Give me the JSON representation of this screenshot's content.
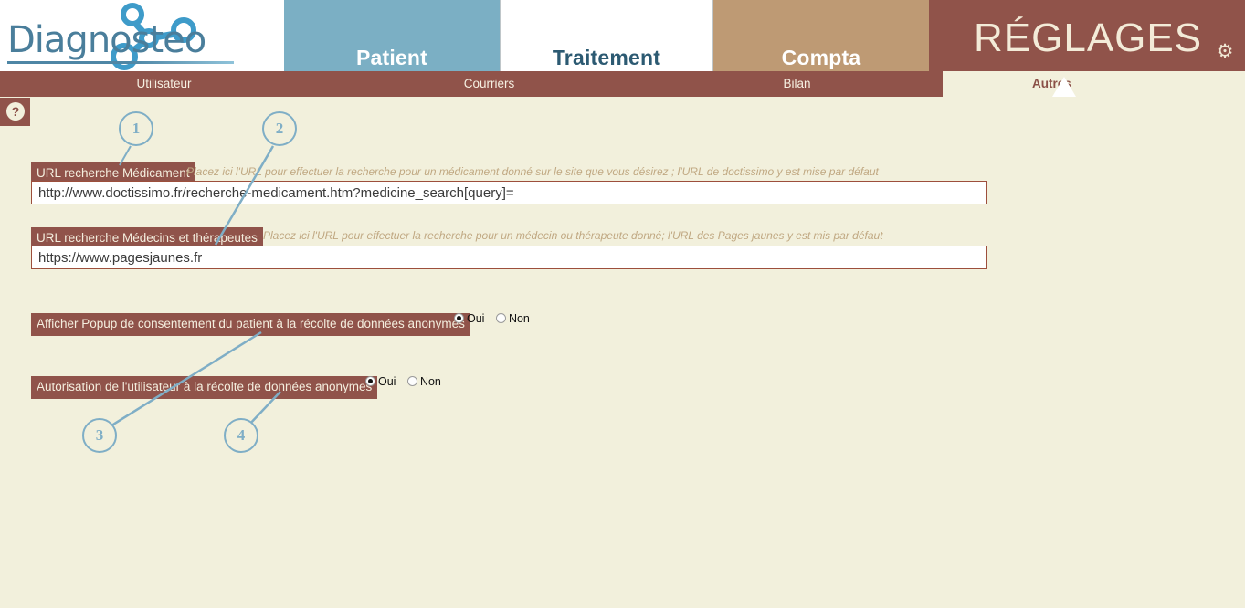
{
  "app": {
    "logo_text": "Diagnosteo",
    "page_title": "RÉGLAGES",
    "gear_icon": "gear-icon",
    "help_icon": "?"
  },
  "colors": {
    "brown": "#90534A",
    "background": "#F2F0DC",
    "patient_tab": "#7BAFC4",
    "compta_tab": "#BE9A74",
    "callout_blue": "#7FAEC6",
    "hint_text": "#C0A882",
    "input_border": "#9D4F3C"
  },
  "main_tabs": [
    {
      "label": "Patient",
      "active": false
    },
    {
      "label": "Traitement",
      "active": true
    },
    {
      "label": "Compta",
      "active": false
    }
  ],
  "sub_tabs": [
    {
      "label": "Utilisateur"
    },
    {
      "label": "Courriers"
    },
    {
      "label": "Bilan"
    },
    {
      "label": "Autres"
    }
  ],
  "form": {
    "rows": [
      {
        "label": "URL recherche Médicament",
        "hint": "Placez ici l'URL pour effectuer la recherche pour un médicament donné sur le site que vous désirez ; l'URL de doctissimo y est mise par défaut",
        "value": "http://www.doctissimo.fr/recherche-medicament.htm?medicine_search[query]="
      },
      {
        "label": "URL recherche Médecins et thérapeutes",
        "hint": "Placez ici l'URL pour effectuer la recherche pour un médecin ou thérapeute donné; l'URL des Pages jaunes y est mis par défaut",
        "value": "https://www.pagesjaunes.fr"
      },
      {
        "label": "Afficher Popup de consentement du patient à la récolte de données anonymes",
        "options": [
          {
            "label": "Oui",
            "selected": true
          },
          {
            "label": "Non",
            "selected": false
          }
        ]
      },
      {
        "label": "Autorisation de l'utilisateur à la récolte de données anonymes",
        "options": [
          {
            "label": "Oui",
            "selected": true
          },
          {
            "label": "Non",
            "selected": false
          }
        ]
      }
    ]
  },
  "callouts": [
    {
      "number": "1"
    },
    {
      "number": "2"
    },
    {
      "number": "3"
    },
    {
      "number": "4"
    }
  ]
}
